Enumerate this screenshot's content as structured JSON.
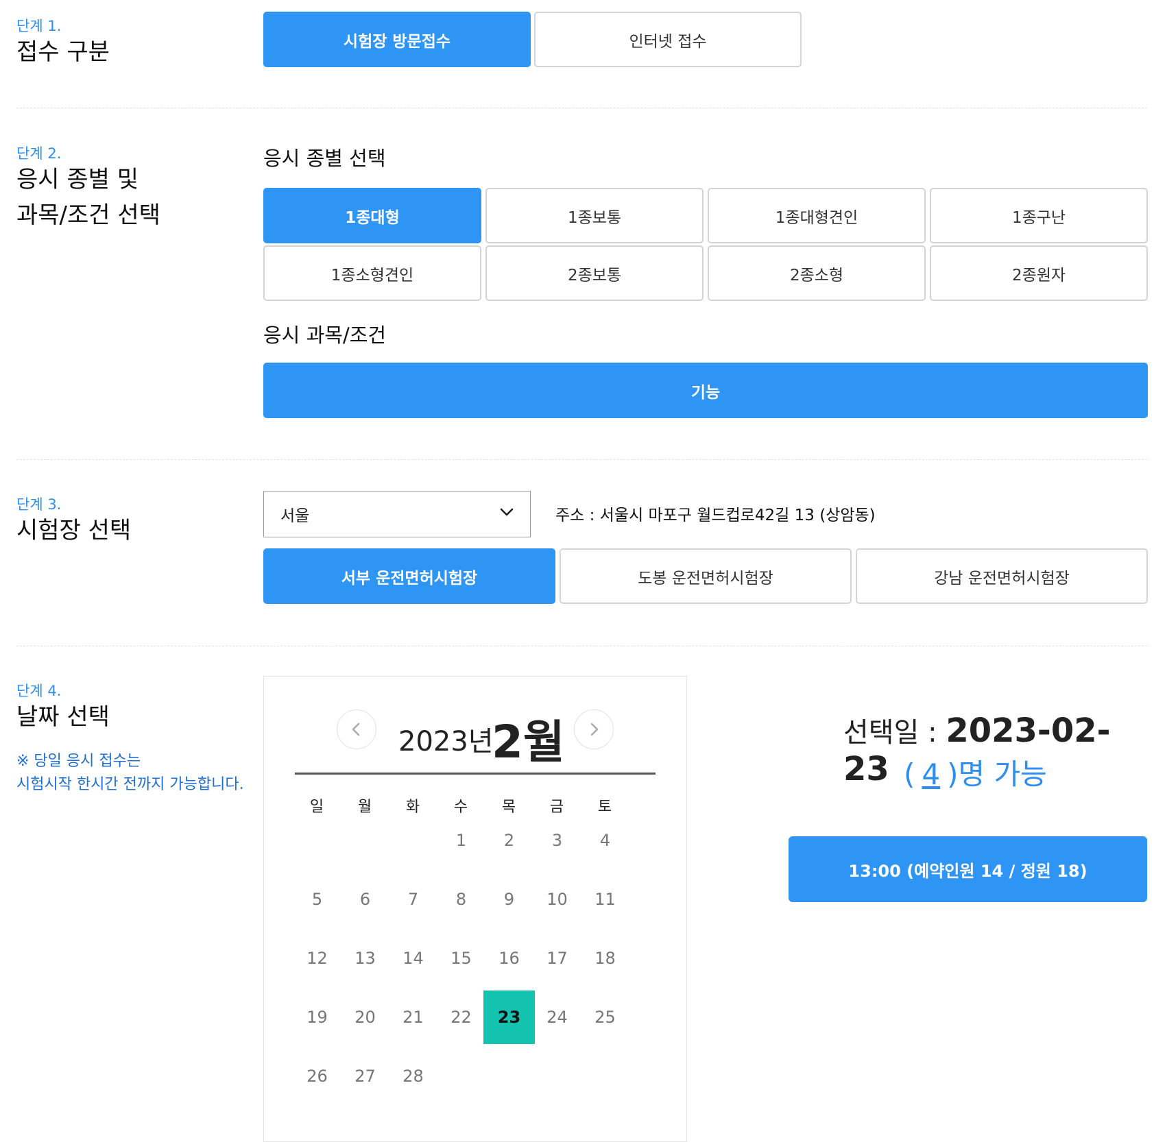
{
  "step1": {
    "label": "단계 1.",
    "title": "접수 구분",
    "options": [
      "시험장 방문접수",
      "인터넷 접수"
    ]
  },
  "step2": {
    "label": "단계 2.",
    "title_line1": "응시 종별 및",
    "title_line2": "과목/조건 선택",
    "type_heading": "응시 종별 선택",
    "types": [
      "1종대형",
      "1종보통",
      "1종대형견인",
      "1종구난",
      "1종소형견인",
      "2종보통",
      "2종소형",
      "2종원자"
    ],
    "subject_heading": "응시 과목/조건",
    "subject": "기능"
  },
  "step3": {
    "label": "단계 3.",
    "title": "시험장 선택",
    "region": "서울",
    "address": "주소 : 서울시 마포구 월드컵로42길 13 (상암동)",
    "centers": [
      "서부 운전면허시험장",
      "도봉 운전면허시험장",
      "강남 운전면허시험장"
    ]
  },
  "step4": {
    "label": "단계 4.",
    "title": "날짜 선택",
    "note_line1": "※ 당일 응시 접수는",
    "note_line2": "시험시작 한시간 전까지 가능합니다.",
    "calendar": {
      "year": "2023년",
      "month": "2월",
      "weekdays": [
        "일",
        "월",
        "화",
        "수",
        "목",
        "금",
        "토"
      ],
      "days": [
        "1",
        "2",
        "3",
        "4",
        "5",
        "6",
        "7",
        "8",
        "9",
        "10",
        "11",
        "12",
        "13",
        "14",
        "15",
        "16",
        "17",
        "18",
        "19",
        "20",
        "21",
        "22",
        "23",
        "24",
        "25",
        "26",
        "27",
        "28"
      ],
      "first_weekday_index": 3,
      "selected_day": "23"
    },
    "selected_label": "선택일 : ",
    "selected_date": "2023-02-23",
    "avail_open": "(",
    "avail_count": "4",
    "avail_close": ")명 가능",
    "slot": "13:00 (예약인원 14 / 정원 18)"
  },
  "colors": {
    "accent": "#2f95f5",
    "selected_day": "#14c2b0",
    "step_label": "#2c8ef0"
  },
  "icons": {
    "select": "chevron-down-icon",
    "prev": "chevron-left-icon",
    "next": "chevron-right-icon"
  }
}
